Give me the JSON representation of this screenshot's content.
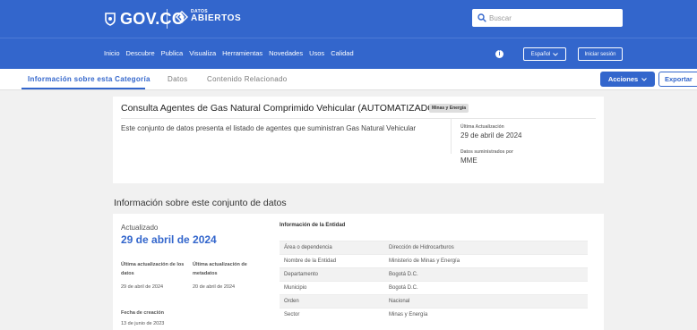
{
  "header": {
    "logo_text": "GOV.CO",
    "datos_small": "DATOS",
    "datos_big": "ABIERTOS",
    "search_placeholder": "Buscar"
  },
  "nav": {
    "links": [
      "Inicio",
      "Descubre",
      "Publica",
      "Visualiza",
      "Herramientas",
      "Novedades",
      "Usos",
      "Calidad"
    ],
    "info_glyph": "i",
    "language": "Español",
    "login": "Iniciar sesión"
  },
  "tabs": {
    "items": [
      "Información sobre esta Categoría",
      "Datos",
      "Contenido Relacionado"
    ],
    "acciones": "Acciones",
    "exportar": "Exportar"
  },
  "dataset": {
    "title": "Consulta Agentes de Gas Natural Comprimido Vehicular (AUTOMATIZADO)",
    "tag": "Minas y Energía",
    "description": "Este conjunto de datos presenta el listado de agentes que suministran Gas Natural Vehicular",
    "last_update_label": "Última Actualización",
    "last_update_value": "29 de abril de 2024",
    "provider_label": "Datos suministrados por",
    "provider_value": "MME"
  },
  "info_section": {
    "title": "Información sobre este conjunto de datos",
    "updated_label": "Actualizado",
    "updated_date": "29 de abril de 2024",
    "data_update_label": "Última actualización de los datos",
    "data_update_value": "29 de abril de 2024",
    "meta_update_label": "Última actualización de metadatos",
    "meta_update_value": "20 de abril de 2024",
    "created_label": "Fecha de creación",
    "created_value": "13 de junio de 2023",
    "entity_title": "Información de la Entidad",
    "entity_rows": [
      {
        "key": "Área o dependencia",
        "value": "Dirección de Hidrocarburos"
      },
      {
        "key": "Nombre de la Entidad",
        "value": "Ministerio de Minas y Energía"
      },
      {
        "key": "Departamento",
        "value": "Bogotá D.C."
      },
      {
        "key": "Municipio",
        "value": "Bogotá D.C."
      },
      {
        "key": "Orden",
        "value": "Nacional"
      },
      {
        "key": "Sector",
        "value": "Minas y Energía"
      }
    ]
  },
  "colors": {
    "brand_blue": "#3366cc",
    "page_bg": "#f1f1f1"
  }
}
